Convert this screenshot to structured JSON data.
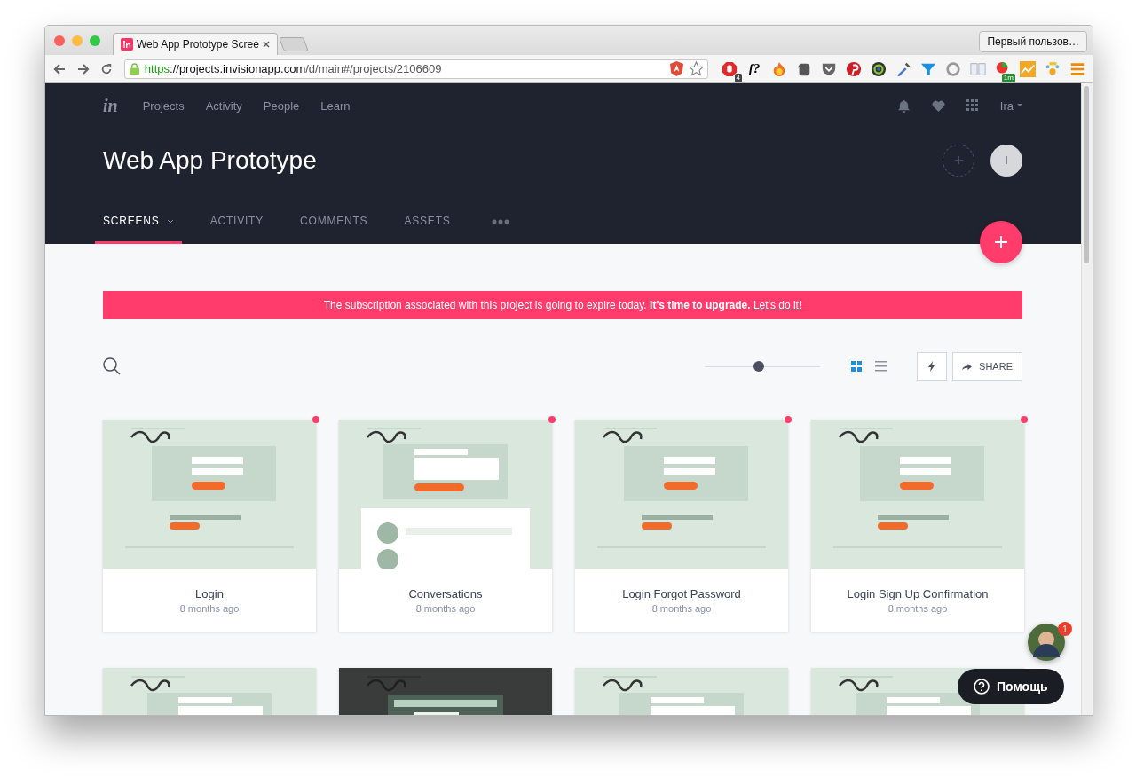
{
  "browser": {
    "tab_title": "Web App Prototype Scree",
    "profile": "Первый пользов…",
    "url": [
      {
        "kind": "scheme",
        "text": "https"
      },
      {
        "kind": "host",
        "text": "://projects.invisionapp.com"
      },
      {
        "kind": "path",
        "text": "/d/main#/projects/2106609"
      }
    ],
    "extensions": [
      {
        "kind": "stop",
        "badge": "4"
      },
      {
        "kind": "text",
        "label": "f?"
      },
      {
        "kind": "flame"
      },
      {
        "kind": "elephant"
      },
      {
        "kind": "pocket"
      },
      {
        "kind": "pin"
      },
      {
        "kind": "lens"
      },
      {
        "kind": "dropper"
      },
      {
        "kind": "funnel"
      },
      {
        "kind": "ring"
      },
      {
        "kind": "panes"
      },
      {
        "kind": "chart",
        "badge": "1m"
      },
      {
        "kind": "graph"
      },
      {
        "kind": "paw"
      },
      {
        "kind": "menu"
      }
    ]
  },
  "nav": {
    "logo": "in",
    "items": [
      "Projects",
      "Activity",
      "People",
      "Learn"
    ],
    "user": "Ira"
  },
  "project": {
    "title": "Web App Prototype",
    "avatar": "I"
  },
  "tabs": [
    {
      "label": "SCREENS",
      "selected": true,
      "dropdown": true
    },
    {
      "label": "ACTIVITY",
      "selected": false,
      "dropdown": false
    },
    {
      "label": "COMMENTS",
      "selected": false,
      "dropdown": false
    },
    {
      "label": "ASSETS",
      "selected": false,
      "dropdown": false
    }
  ],
  "banner": {
    "text": "The subscription associated with this project is going to expire today. **It's time to upgrade.**",
    "link": "Let's do it!"
  },
  "toolbar": {
    "zoom": {
      "level": 0.47
    },
    "views": [
      {
        "kind": "grid",
        "selected": true
      },
      {
        "kind": "list",
        "selected": false
      }
    ],
    "share": "SHARE"
  },
  "screens": [
    {
      "title": "Login",
      "time": "8 months ago",
      "unread": true
    },
    {
      "title": "Conversations",
      "time": "8 months ago",
      "unread": true
    },
    {
      "title": "Login Forgot Password",
      "time": "8 months ago",
      "unread": true
    },
    {
      "title": "Login Sign Up Confirmation",
      "time": "8 months ago",
      "unread": true
    }
  ],
  "chat": {
    "badge": "1"
  },
  "help": {
    "label": "Помощь"
  }
}
